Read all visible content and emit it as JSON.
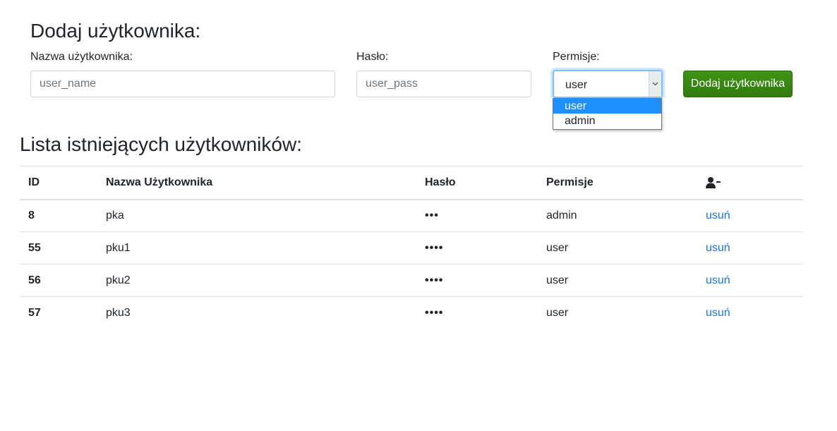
{
  "add_form": {
    "title": "Dodaj użytkownika:",
    "username": {
      "label": "Nazwa użytkownika:",
      "placeholder": "user_name"
    },
    "password": {
      "label": "Hasło:",
      "placeholder": "user_pass"
    },
    "permissions": {
      "label": "Permisje:",
      "value": "user",
      "options": [
        "user",
        "admin"
      ],
      "highlighted": "user"
    },
    "submit_label": "Dodaj użytkownika",
    "submit_color": "#3b8a13"
  },
  "users_list": {
    "title": "Lista istniejących użytkowników:",
    "columns": {
      "id": "ID",
      "name": "Nazwa Użytkownika",
      "password": "Hasło",
      "permissions": "Permisje",
      "action_icon": "user-minus-icon"
    },
    "rows": [
      {
        "id": "8",
        "name": "pka",
        "password": "•••",
        "permissions": "admin",
        "action": "usuń"
      },
      {
        "id": "55",
        "name": "pku1",
        "password": "••••",
        "permissions": "user",
        "action": "usuń"
      },
      {
        "id": "56",
        "name": "pku2",
        "password": "••••",
        "permissions": "user",
        "action": "usuń"
      },
      {
        "id": "57",
        "name": "pku3",
        "password": "••••",
        "permissions": "user",
        "action": "usuń"
      }
    ],
    "link_color": "#1a73e8"
  }
}
